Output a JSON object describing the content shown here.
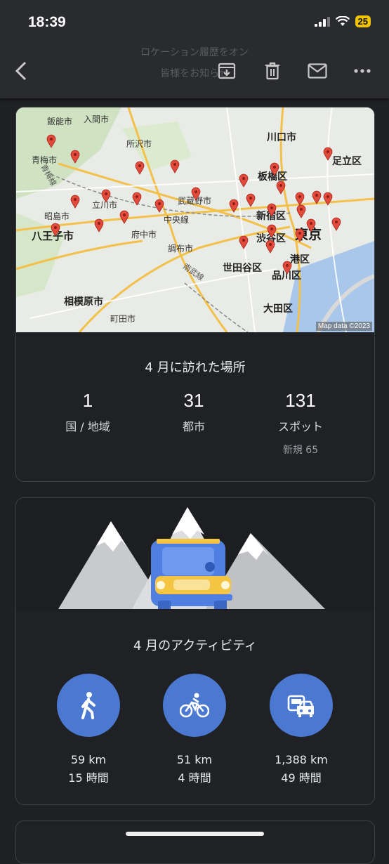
{
  "status": {
    "time": "18:39",
    "battery": "25"
  },
  "toolbar": {
    "ghost_title": "ロケーション履歴をオン",
    "ghost_subtitle": "皆様をお知らせ"
  },
  "icons": [
    "back-arrow-icon",
    "archive-icon",
    "delete-icon",
    "mail-icon",
    "more-icon",
    "signal-icon",
    "wifi-icon",
    "walking-icon",
    "cycling-icon",
    "transport-icon",
    "map-pin-icon"
  ],
  "colors": {
    "accent_blue": "#4b78d0",
    "pin_red": "#e24a3b",
    "card_bg": "#202124"
  },
  "map": {
    "attribution": "Map data ©2023",
    "labels": {
      "iruma": "入間市",
      "hanno": "飯能市",
      "tokorozawa": "所沢市",
      "kawaguchi": "川口市",
      "adachi": "足立区",
      "ome": "青梅市",
      "omeline": "青梅線",
      "itabashi": "板橋区",
      "tachikawa": "立川市",
      "musashino": "武蔵野市",
      "chuoline": "中央線",
      "akishima": "昭島市",
      "shinjuku": "新宿区",
      "fuchu": "府中市",
      "shibuya": "渋谷区",
      "tokyo": "東京",
      "hachioji": "八王子市",
      "chofu": "調布市",
      "minato": "港区",
      "nambu": "南武線",
      "setagaya": "世田谷区",
      "shinagawa": "品川区",
      "sagamihara": "相模原市",
      "ota": "大田区",
      "machida": "町田市"
    }
  },
  "places": {
    "title": "4 月に訪れた場所",
    "stats": [
      {
        "value": "1",
        "label": "国 / 地域"
      },
      {
        "value": "31",
        "label": "都市"
      },
      {
        "value": "131",
        "label": "スポット",
        "sub": "新規 65"
      }
    ]
  },
  "activity": {
    "title": "4 月のアクティビティ",
    "items": [
      {
        "distance": "59 km",
        "duration": "15 時間"
      },
      {
        "distance": "51 km",
        "duration": "4 時間"
      },
      {
        "distance": "1,388 km",
        "duration": "49 時間"
      }
    ]
  }
}
